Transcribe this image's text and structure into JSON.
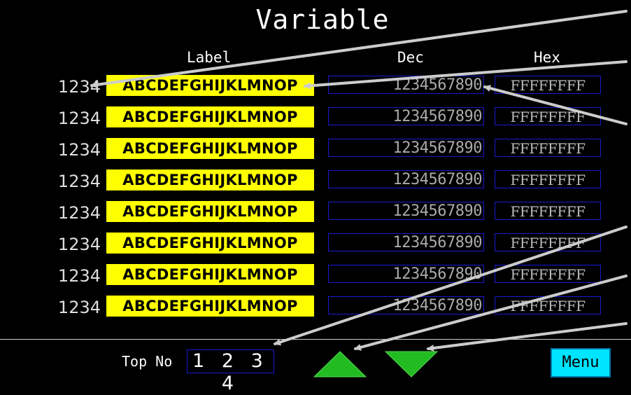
{
  "screen": {
    "title": "Variable",
    "columns": {
      "label": "Label",
      "dec": "Dec",
      "hex": "Hex"
    }
  },
  "rows": [
    {
      "num": "1234",
      "label": "ABCDEFGHIJKLMNOP",
      "dec": "1234567890",
      "hex": "FFFFFFFF"
    },
    {
      "num": "1234",
      "label": "ABCDEFGHIJKLMNOP",
      "dec": "1234567890",
      "hex": "FFFFFFFF"
    },
    {
      "num": "1234",
      "label": "ABCDEFGHIJKLMNOP",
      "dec": "1234567890",
      "hex": "FFFFFFFF"
    },
    {
      "num": "1234",
      "label": "ABCDEFGHIJKLMNOP",
      "dec": "1234567890",
      "hex": "FFFFFFFF"
    },
    {
      "num": "1234",
      "label": "ABCDEFGHIJKLMNOP",
      "dec": "1234567890",
      "hex": "FFFFFFFF"
    },
    {
      "num": "1234",
      "label": "ABCDEFGHIJKLMNOP",
      "dec": "1234567890",
      "hex": "FFFFFFFF"
    },
    {
      "num": "1234",
      "label": "ABCDEFGHIJKLMNOP",
      "dec": "1234567890",
      "hex": "FFFFFFFF"
    },
    {
      "num": "1234",
      "label": "ABCDEFGHIJKLMNOP",
      "dec": "1234567890",
      "hex": "FFFFFFFF"
    }
  ],
  "footer": {
    "top_no_label": "Top No",
    "top_no_value": "1 2 3 4",
    "scroll_up_icon": "triangle-up-icon",
    "scroll_down_icon": "triangle-down-icon",
    "menu_label": "Menu"
  },
  "colors": {
    "background": "#000000",
    "label_fill": "#ffff00",
    "field_border": "#1a1ad0",
    "arrow_green": "#22bb22",
    "menu_fill": "#00e5ff",
    "callout_arrow": "#cccccc"
  }
}
